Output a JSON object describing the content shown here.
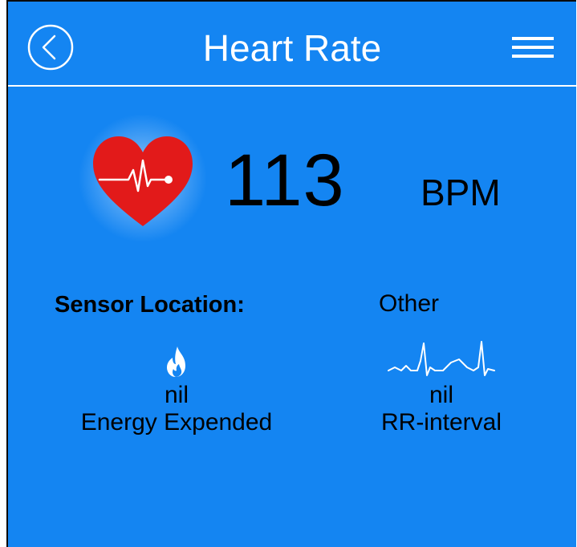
{
  "header": {
    "title": "Heart Rate"
  },
  "heart_rate": {
    "value": "113",
    "unit": "BPM"
  },
  "sensor": {
    "label": "Sensor Location:",
    "value": "Other"
  },
  "energy": {
    "value": "nil",
    "label": "Energy Expended",
    "icon": "flame-icon"
  },
  "rr": {
    "value": "nil",
    "label": "RR-interval",
    "icon": "ecg-wave-icon"
  },
  "colors": {
    "background": "#1485f2",
    "heart": "#e21a1a",
    "text": "#000000",
    "header_text": "#ffffff"
  }
}
